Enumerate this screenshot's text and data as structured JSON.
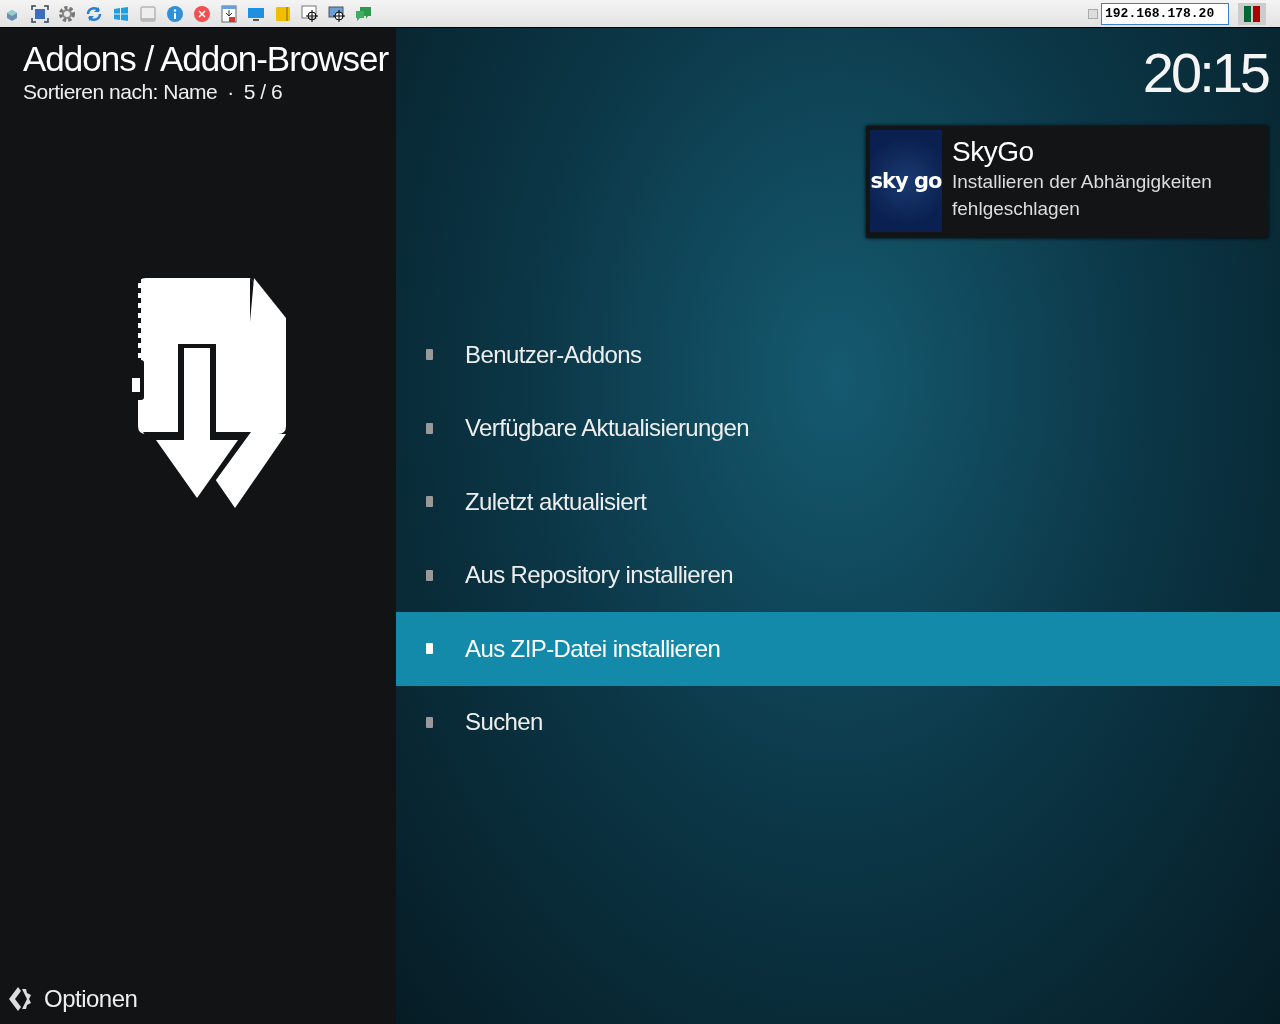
{
  "toolbar": {
    "address": "192.168.178.20"
  },
  "header": {
    "title": "Addons / Addon-Browser",
    "sort": "Sortieren nach: Name",
    "separator": "·",
    "position": "5 / 6",
    "clock": "20:15"
  },
  "notification": {
    "logo_text": "sky go",
    "title": "SkyGo",
    "message": "Installieren der Abhängigkeiten fehlgeschlagen"
  },
  "menu": [
    {
      "label": "Benutzer-Addons",
      "selected": false
    },
    {
      "label": "Verfügbare Aktualisierungen",
      "selected": false
    },
    {
      "label": "Zuletzt aktualisiert",
      "selected": false
    },
    {
      "label": "Aus Repository installieren",
      "selected": false
    },
    {
      "label": "Aus ZIP-Datei installieren",
      "selected": true
    },
    {
      "label": "Suchen",
      "selected": false
    }
  ],
  "options": {
    "label": "Optionen"
  }
}
